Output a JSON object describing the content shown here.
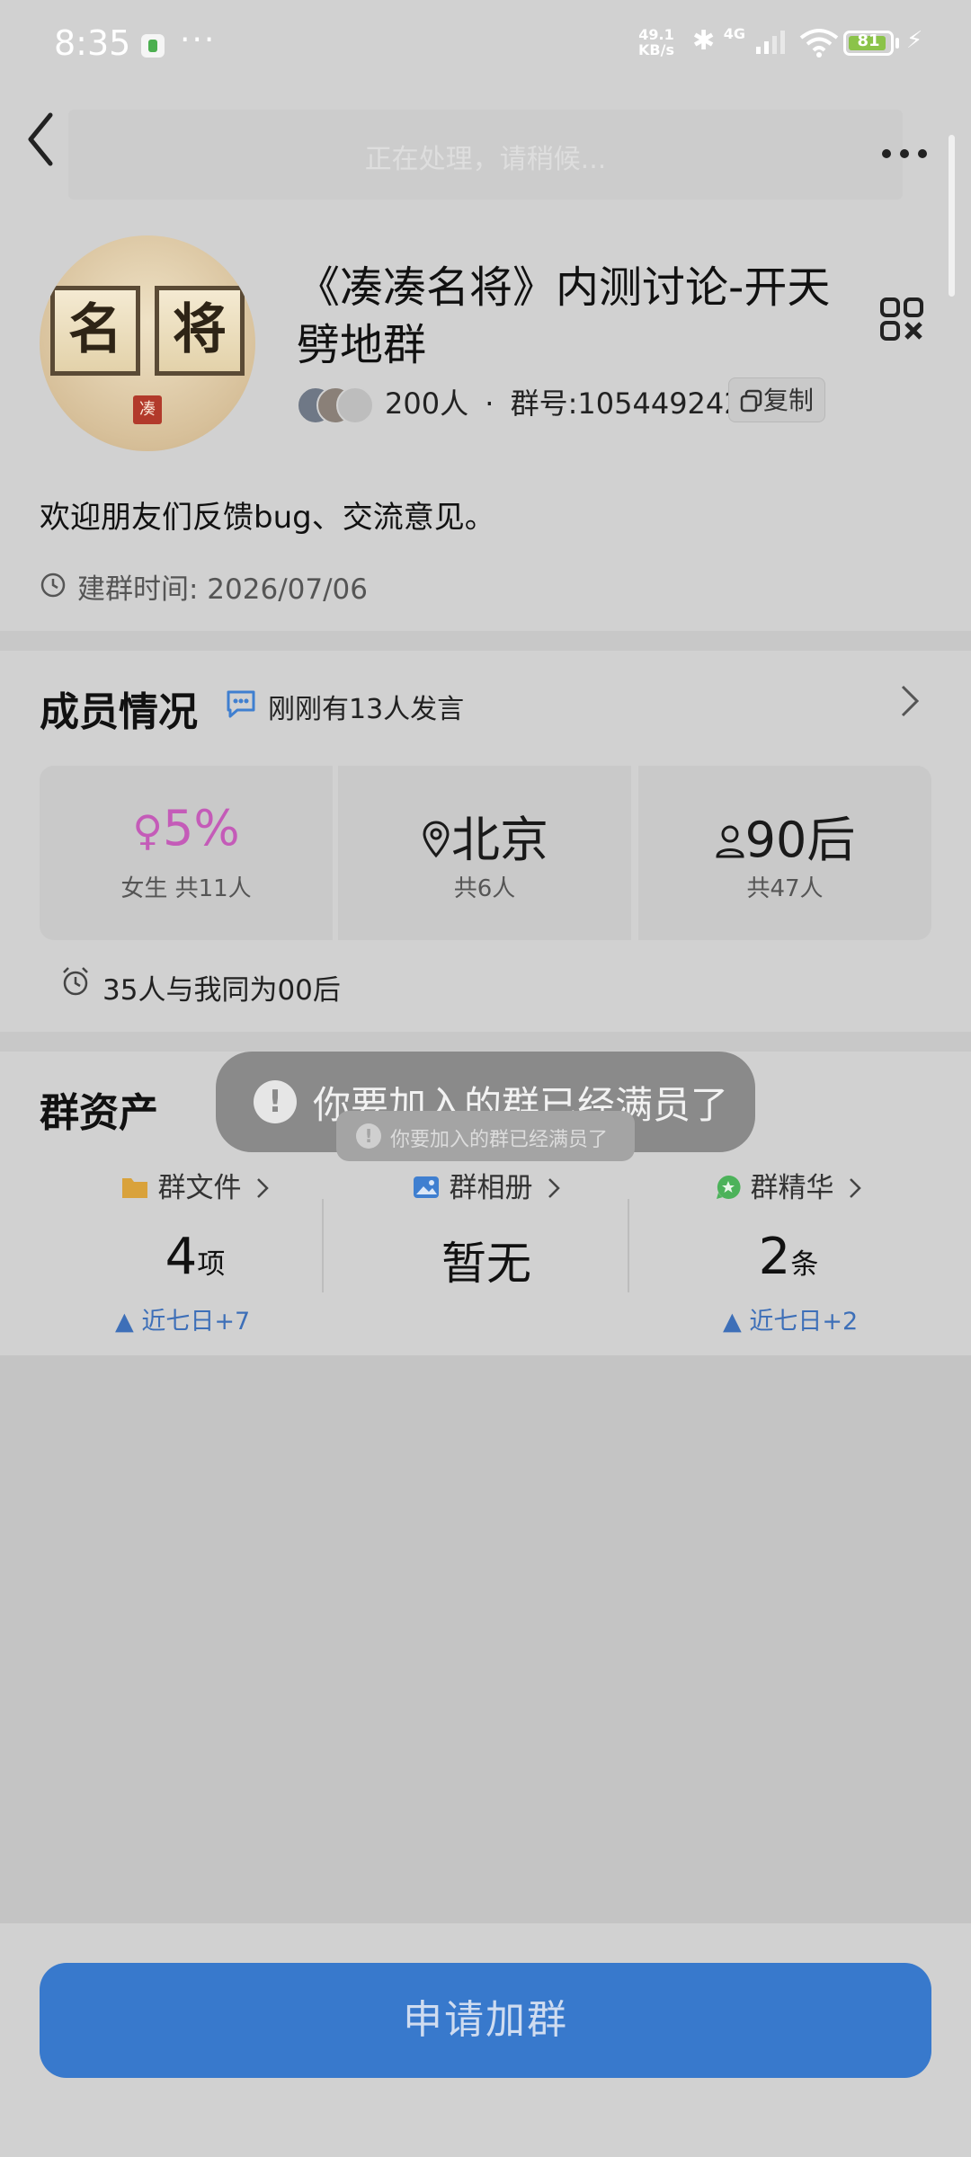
{
  "status_bar": {
    "time": "8:35",
    "dots": "···",
    "net_speed_value": "49.1",
    "net_speed_unit": "KB/s",
    "signal_label": "4G",
    "battery": "81"
  },
  "header": {
    "processing_text": "正在处理，请稍候..."
  },
  "group": {
    "title": "《凑凑名将》内测讨论-开天劈地群",
    "avatar_text_left": "名",
    "avatar_text_right": "将",
    "avatar_stamp": "凑",
    "member_count": "200人",
    "dot_sep": "·",
    "group_number": "群号:1054492421",
    "copy_label": "复制",
    "description": "欢迎朋友们反馈bug、交流意见。",
    "created_time": "建群时间: 2026/07/06"
  },
  "members": {
    "title": "成员情况",
    "recent_speakers": "刚刚有13人发言",
    "cards": [
      {
        "main": "5%",
        "sub": "女生 共11人",
        "accent": "#c45bb8"
      },
      {
        "main": "北京",
        "sub": "共6人"
      },
      {
        "main": "90后",
        "sub": "共47人"
      }
    ],
    "same_age": "35人与我同为00后"
  },
  "assets": {
    "title": "群资产",
    "items": [
      {
        "label": "群文件",
        "value": "4",
        "unit": "项",
        "trend": "近七日+7",
        "icon_color": "#d9a23b"
      },
      {
        "label": "群相册",
        "value": "暂无",
        "unit": "",
        "trend": "",
        "icon_color": "#3f7fd0"
      },
      {
        "label": "群精华",
        "value": "2",
        "unit": "条",
        "trend": "近七日+2",
        "icon_color": "#4cb25a"
      }
    ]
  },
  "toast": {
    "big": "你要加入的群已经满员了",
    "small": "你要加入的群已经满员了"
  },
  "footer": {
    "join_label": "申请加群"
  }
}
